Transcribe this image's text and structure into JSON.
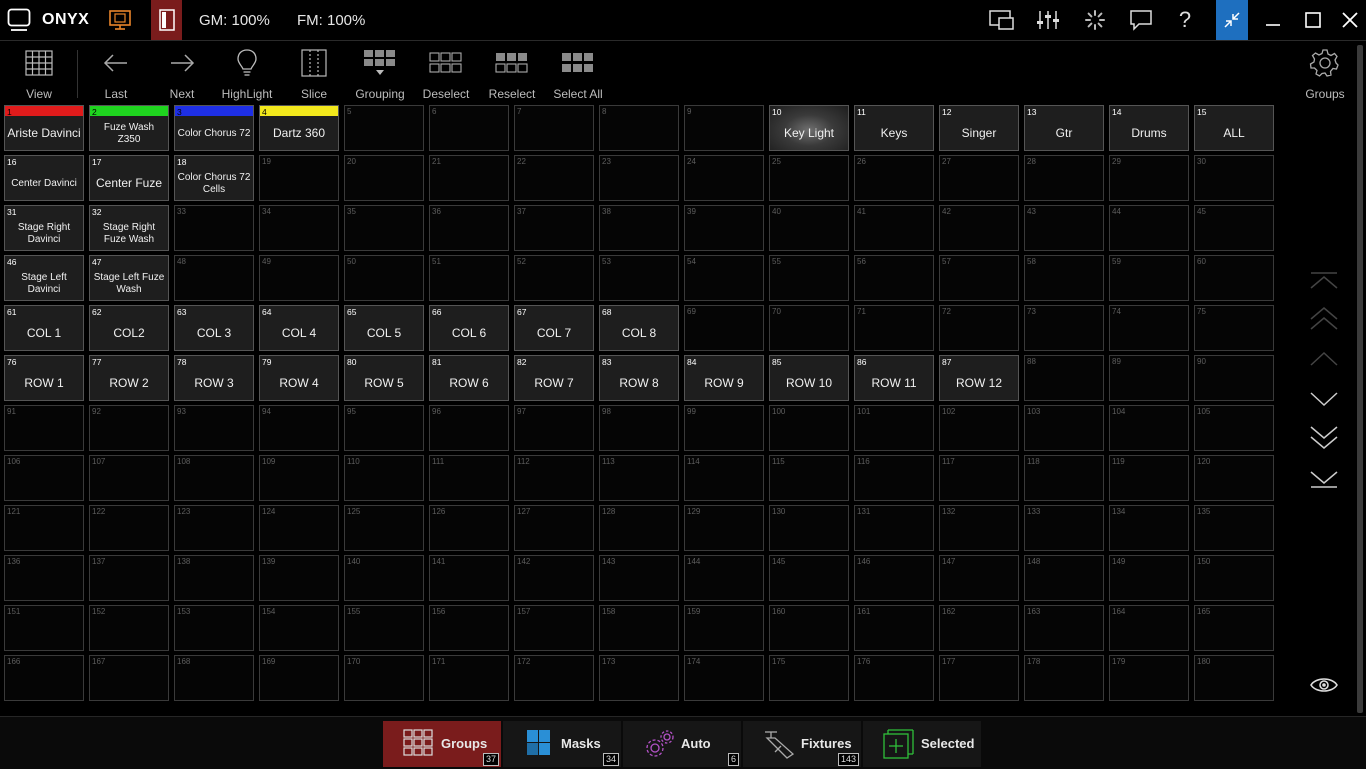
{
  "titlebar": {
    "app_name": "ONYX",
    "gm": "GM: 100%",
    "fm": "FM: 100%"
  },
  "toolbar": {
    "view": "View",
    "last": "Last",
    "next": "Next",
    "highlight": "HighLight",
    "slice": "Slice",
    "grouping": "Grouping",
    "deselect": "Deselect",
    "reselect": "Reselect",
    "select_all": "Select All",
    "groups": "Groups"
  },
  "groups": [
    {
      "num": 1,
      "name": "Ariste Davinci",
      "color": "#e01b1b",
      "size": 12
    },
    {
      "num": 2,
      "name": "Fuze Wash Z350",
      "color": "#1fd41f",
      "size": 10
    },
    {
      "num": 3,
      "name": "Color Chorus 72",
      "color": "#1e2fe6",
      "size": 10
    },
    {
      "num": 4,
      "name": "Dartz 360",
      "color": "#f2e81c",
      "size": 12
    },
    {
      "num": 10,
      "name": "Key Light",
      "size": 12,
      "selected": true
    },
    {
      "num": 11,
      "name": "Keys",
      "size": 12
    },
    {
      "num": 12,
      "name": "Singer",
      "size": 12
    },
    {
      "num": 13,
      "name": "Gtr",
      "size": 12
    },
    {
      "num": 14,
      "name": "Drums",
      "size": 12
    },
    {
      "num": 15,
      "name": "ALL",
      "size": 12
    },
    {
      "num": 16,
      "name": "Center Davinci",
      "size": 10
    },
    {
      "num": 17,
      "name": "Center Fuze",
      "size": 12
    },
    {
      "num": 18,
      "name": "Color Chorus 72 Cells",
      "size": 10
    },
    {
      "num": 31,
      "name": "Stage Right Davinci",
      "size": 10
    },
    {
      "num": 32,
      "name": "Stage Right Fuze Wash",
      "size": 10
    },
    {
      "num": 46,
      "name": "Stage Left Davinci",
      "size": 10
    },
    {
      "num": 47,
      "name": "Stage Left Fuze Wash",
      "size": 10
    },
    {
      "num": 61,
      "name": "COL 1",
      "size": 12
    },
    {
      "num": 62,
      "name": "COL2",
      "size": 12
    },
    {
      "num": 63,
      "name": "COL 3",
      "size": 12
    },
    {
      "num": 64,
      "name": "COL 4",
      "size": 12
    },
    {
      "num": 65,
      "name": "COL 5",
      "size": 12
    },
    {
      "num": 66,
      "name": "COL 6",
      "size": 12
    },
    {
      "num": 67,
      "name": "COL 7",
      "size": 12
    },
    {
      "num": 68,
      "name": "COL 8",
      "size": 12
    },
    {
      "num": 76,
      "name": "ROW 1",
      "size": 12
    },
    {
      "num": 77,
      "name": "ROW 2",
      "size": 12
    },
    {
      "num": 78,
      "name": "ROW 3",
      "size": 12
    },
    {
      "num": 79,
      "name": "ROW 4",
      "size": 12
    },
    {
      "num": 80,
      "name": "ROW 5",
      "size": 12
    },
    {
      "num": 81,
      "name": "ROW 6",
      "size": 12
    },
    {
      "num": 82,
      "name": "ROW 7",
      "size": 12
    },
    {
      "num": 83,
      "name": "ROW 8",
      "size": 12
    },
    {
      "num": 84,
      "name": "ROW 9",
      "size": 12
    },
    {
      "num": 85,
      "name": "ROW 10",
      "size": 12
    },
    {
      "num": 86,
      "name": "ROW 11",
      "size": 12
    },
    {
      "num": 87,
      "name": "ROW 12",
      "size": 12
    }
  ],
  "bottom_tabs": [
    {
      "label": "Groups",
      "badge": "37",
      "icon": "groups-grid-icon",
      "active": true
    },
    {
      "label": "Masks",
      "badge": "34",
      "icon": "masks-icon",
      "active": false
    },
    {
      "label": "Auto",
      "badge": "6",
      "icon": "gears-icon",
      "active": false
    },
    {
      "label": "Fixtures",
      "badge": "143",
      "icon": "fixture-icon",
      "active": false
    },
    {
      "label": "Selected",
      "badge": "",
      "icon": "selected-icon",
      "active": false
    }
  ],
  "colors": {
    "accent_active_tab": "#7a1c1c",
    "window_active_button": "#1e6fbf",
    "monitor_icon": "#e8852a",
    "masks_icon": "#2a8fd6",
    "auto_icon": "#b452c8",
    "selected_icon": "#2fbf3a"
  }
}
